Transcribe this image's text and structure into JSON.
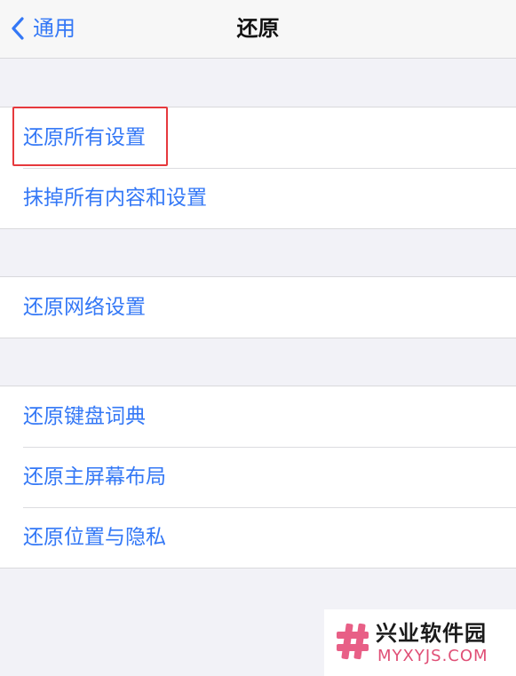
{
  "nav": {
    "back_label": "通用",
    "title": "还原"
  },
  "groups": [
    {
      "items": [
        {
          "label": "还原所有设置",
          "highlighted": true
        },
        {
          "label": "抹掉所有内容和设置"
        }
      ]
    },
    {
      "items": [
        {
          "label": "还原网络设置"
        }
      ]
    },
    {
      "items": [
        {
          "label": "还原键盘词典"
        },
        {
          "label": "还原主屏幕布局"
        },
        {
          "label": "还原位置与隐私"
        }
      ]
    }
  ],
  "watermark": {
    "name": "兴业软件园",
    "url": "MYXYJS.COM"
  },
  "colors": {
    "accent": "#3478f6",
    "highlight_box": "#e6393d",
    "background": "#f2f2f7",
    "watermark_url": "#e04f76"
  },
  "icons": {
    "back": "chevron-left-icon",
    "watermark_logo": "hash-logo-icon"
  }
}
